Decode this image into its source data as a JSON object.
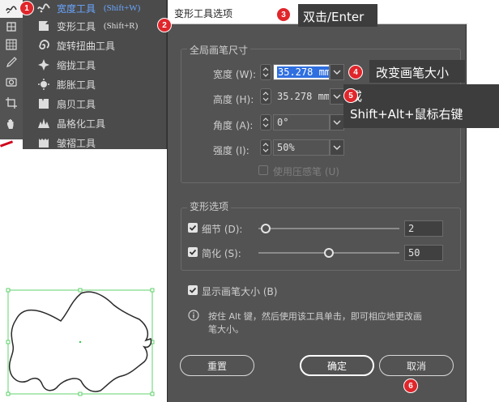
{
  "toolbar": {
    "tools": [
      "width-tool-icon",
      "free-distort-icon",
      "rotate-view-icon",
      "eyedropper-icon",
      "camera-icon",
      "crop-icon",
      "hand-icon"
    ]
  },
  "flyout": {
    "items": [
      {
        "label": "宽度工具",
        "shortcut": "(Shift+W)",
        "icon": "width-tool-icon",
        "selected": true
      },
      {
        "label": "变形工具",
        "shortcut": "(Shift+R)",
        "icon": "warp-tool-icon",
        "selected": false
      },
      {
        "label": "旋转扭曲工具",
        "shortcut": "",
        "icon": "twirl-tool-icon",
        "selected": false
      },
      {
        "label": "缩拢工具",
        "shortcut": "",
        "icon": "pucker-tool-icon",
        "selected": false
      },
      {
        "label": "膨胀工具",
        "shortcut": "",
        "icon": "bloat-tool-icon",
        "selected": false
      },
      {
        "label": "扇贝工具",
        "shortcut": "",
        "icon": "scallop-tool-icon",
        "selected": false
      },
      {
        "label": "晶格化工具",
        "shortcut": "",
        "icon": "crystallize-tool-icon",
        "selected": false
      },
      {
        "label": "皱褶工具",
        "shortcut": "",
        "icon": "wrinkle-tool-icon",
        "selected": false
      }
    ]
  },
  "markers": [
    "1",
    "2",
    "3",
    "4",
    "5",
    "6"
  ],
  "callouts": {
    "double_click": "双击/Enter",
    "change_size": "改变画笔大小",
    "or": "或",
    "shortcut": "Shift+Alt+鼠标右键"
  },
  "dialog": {
    "title": "变形工具选项",
    "global_group": "全局画笔尺寸",
    "width_label": "宽度 (W):",
    "width_value": "35.278 mm",
    "height_label": "高度 (H):",
    "height_value": "35.278 mm",
    "angle_label": "角度 (A):",
    "angle_value": "0°",
    "intensity_label": "强度 (I):",
    "intensity_value": "50%",
    "pressure_label": "使用压感笔 (U)",
    "warp_group": "变形选项",
    "detail_label": "细节 (D):",
    "detail_value": "2",
    "detail_level": 0.05,
    "simplify_label": "简化 (S):",
    "simplify_value": "50",
    "simplify_level": 0.5,
    "show_brush_label": "显示画笔大小 (B)",
    "info_text_1": "按住 Alt 键，然后使用该工具单击，即可相应地更改画",
    "info_text_2": "笔大小。",
    "reset_label": "重置",
    "ok_label": "确定",
    "cancel_label": "取消"
  },
  "colors": {
    "accent_blue": "#6aa6ff",
    "marker_red": "#e0262b",
    "dialog_bg": "#535353",
    "shape_stroke": "#2a2a2a",
    "selection_green": "#3cc84a"
  }
}
